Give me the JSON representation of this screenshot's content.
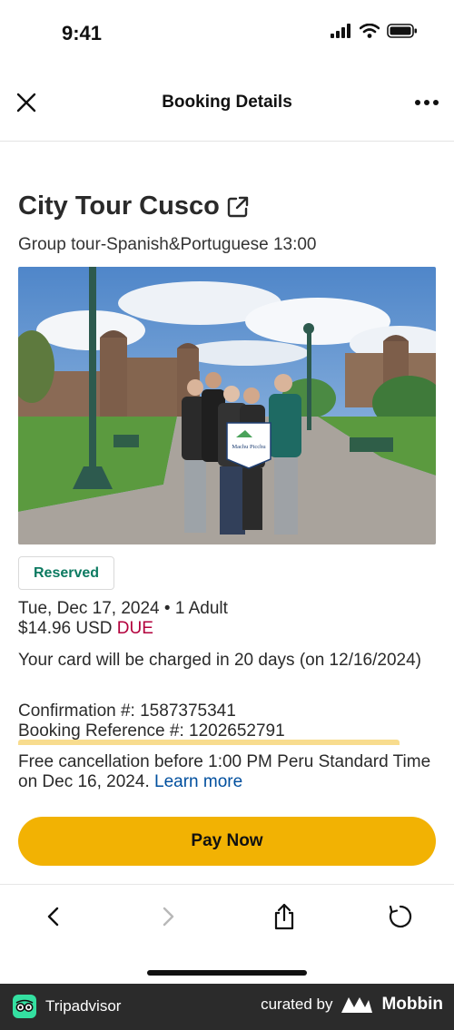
{
  "status_bar": {
    "time": "9:41"
  },
  "header": {
    "title": "Booking Details"
  },
  "tour": {
    "title": "City Tour Cusco",
    "subtitle": "Group tour-Spanish&Portuguese 13:00",
    "photo_flag_text": "Machu Picchu"
  },
  "booking": {
    "status": "Reserved",
    "date_line": "Tue, Dec 17, 2024 • 1 Adult",
    "price": "$14.96 USD",
    "due_label": "DUE",
    "charge_notice": "Your card will be charged in 20 days (on 12/16/2024)",
    "confirmation": "Confirmation #: 1587375341",
    "booking_reference": "Booking Reference #: 1202652791",
    "cancellation": "Free cancellation before 1:00 PM Peru Standard Time on Dec 16, 2024.",
    "learn_more": "Learn more"
  },
  "actions": {
    "pay_now": "Pay Now"
  },
  "footer": {
    "brand": "Tripadvisor",
    "curated_by": "curated by",
    "mobbin": "Mobbin"
  },
  "colors": {
    "accent_yellow": "#f2b203",
    "reserved_green": "#0c7a61",
    "due_red": "#b3003c",
    "link_blue": "#004f9e",
    "tripadvisor_green": "#34e0a1"
  },
  "icons": [
    "signal-icon",
    "wifi-icon",
    "battery-icon",
    "close-icon",
    "more-icon",
    "external-link-icon",
    "back-icon",
    "forward-icon",
    "share-icon",
    "refresh-icon",
    "tripadvisor-logo-icon",
    "mobbin-logo-icon"
  ]
}
